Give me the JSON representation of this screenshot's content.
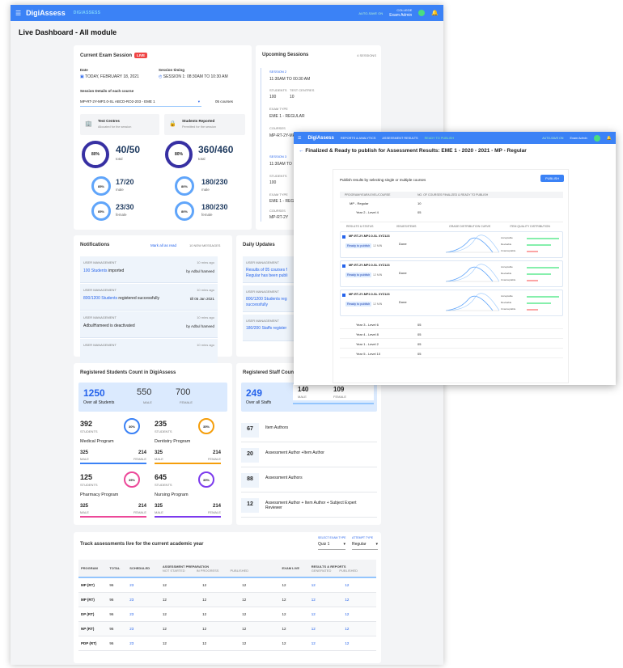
{
  "topbar": {
    "app_name": "DigiAssess",
    "env": "DIGIASSESS",
    "status": "AUTO-SAVE ON",
    "user_role": "COLLEGE",
    "user_name": "Exam Admin"
  },
  "page_title": "Live Dashboard - All module",
  "exam_session": {
    "title": "Current Exam Session",
    "live": "LIVE",
    "date_label": "Date",
    "date_value": "TODAY, FEBRUARY 18, 2021",
    "timing_label": "Session timing",
    "timing_value": "SESSION 1: 08:30AM TO 10:30 AM",
    "course_label": "Session Details of each course",
    "course_value": "MP-RT-2Y-MP2.0-SL ABCD-RO2-203 - EME 1",
    "courses_count": "05 courses",
    "test_centres": "Test Centres",
    "test_centres_sub": "Allocated for the session",
    "students_reported": "Students Reported",
    "students_reported_sub": "Permitted for the session",
    "tc_pct": "80%",
    "tc_value": "40/50",
    "tc_total": "total",
    "tc_male_pct": "85%",
    "tc_male": "17/20",
    "tc_male_label": "male",
    "tc_female_pct": "85%",
    "tc_female": "23/30",
    "tc_female_label": "female",
    "sr_pct": "80%",
    "sr_value": "360/460",
    "sr_total": "total",
    "sr_male_pct": "80%",
    "sr_male": "180/230",
    "sr_male_label": "male",
    "sr_female_pct": "80%",
    "sr_female": "180/230",
    "sr_female_label": "female"
  },
  "upcoming": {
    "title": "Upcoming Sessions",
    "count": "4 SESSIONS",
    "s1_label": "SESSION 2",
    "s1_time": "11:30AM TO 00:30 AM",
    "students_label": "STUDENTS",
    "centres_label": "TEST CENTRES",
    "students": "100",
    "centres": "10",
    "exam_type_label": "EXAM TYPE",
    "exam_type": "EME 1 - REGULAR",
    "courses_label": "COURSES",
    "course1": "MP-RT-2Y-MP2.0-SL ABCD-RO2-203",
    "s2_label": "SESSION 3",
    "s2_time": "11:30AM TO",
    "s2_students": "100",
    "s2_exam": "EME 1 - REG",
    "s2_course": "MP-RT-2Y"
  },
  "notifications": {
    "title": "Notifications",
    "mark": "Mark all as read",
    "new": "10 NEW MESSAGES",
    "items": [
      {
        "cat": "USER MANAGEMENT",
        "time": "10 mins ago",
        "text_b": "100 Students",
        "text": " imported",
        "by": "by Adbul hameed"
      },
      {
        "cat": "USER MANAGEMENT",
        "time": "10 mins ago",
        "text_b": "800/1200 Students",
        "text": " registered successfully",
        "by": "till 05 Jan 2021"
      },
      {
        "cat": "USER MANAGEMENT",
        "time": "10 mins ago",
        "text_b": "",
        "text": "AdbulHameed is deactivated",
        "by": "by Adbul hameed"
      },
      {
        "cat": "USER MANAGEMENT",
        "time": "10 mins ago",
        "text_b": "",
        "text": "",
        "by": ""
      }
    ]
  },
  "daily": {
    "title": "Daily Updates",
    "items": [
      {
        "cat": "USER MANAGEMENT",
        "text": "Results of 05 courses f",
        "text2": "Regular has been publi"
      },
      {
        "cat": "USER MANAGEMENT",
        "text": "800/1200 Students reg",
        "text2": "successfully"
      },
      {
        "cat": "USER MANAGEMENT",
        "text": "180/200 Staffs register",
        "text2": ""
      }
    ]
  },
  "students_count": {
    "title": "Registered Students Count in DigiAssess",
    "total": "1250",
    "total_label": "Over all Students",
    "male": "550",
    "male_label": "MALE",
    "female": "700",
    "female_label": "FEMALE",
    "programs": [
      {
        "count": "392",
        "sub": "STUDENTS",
        "pct": "30%",
        "name": "Medical Program",
        "male": "325",
        "female": "214",
        "color": "#3b82f6"
      },
      {
        "count": "235",
        "sub": "STUDENTS",
        "pct": "35%",
        "name": "Dentistry Program",
        "male": "325",
        "female": "214",
        "color": "#f59e0b"
      },
      {
        "count": "125",
        "sub": "STUDENTS",
        "pct": "35%",
        "name": "Pharmacy Program",
        "male": "325",
        "female": "214",
        "color": "#ec4899"
      },
      {
        "count": "645",
        "sub": "STUDENTS",
        "pct": "35%",
        "name": "Nursing Program",
        "male": "325",
        "female": "214",
        "color": "#7c3aed"
      }
    ],
    "m_label": "MALE",
    "f_label": "FEMALE"
  },
  "staff_count": {
    "title": "Registered Staff Count",
    "total": "249",
    "total_label": "Over all Staffs",
    "male": "140",
    "male_label": "MALE",
    "female": "109",
    "female_label": "FEMALE",
    "roles": [
      {
        "n": "67",
        "name": "Item Authors"
      },
      {
        "n": "20",
        "name": "Assessment Author +Item Author"
      },
      {
        "n": "88",
        "name": "Assessment Authors"
      },
      {
        "n": "12",
        "name": "Assessment Author + Item Author + Subject Expert Reviewer"
      }
    ]
  },
  "track": {
    "title": "Track assessments live for the current academic year",
    "exam_type_label": "SELECT EXAM TYPE",
    "exam_type": "Quiz 1",
    "attempt_label": "ATTEMPT TYPE",
    "attempt": "Regular",
    "headers": {
      "program": "PROGRAM",
      "total": "TOTAL",
      "scheduled": "SCHEDULED",
      "prep": "ASSESSMENT PREPARATION",
      "not_started": "NOT STARTED",
      "in_progress": "IN PROGRESS",
      "published": "PUBLISHED",
      "exam_live": "EXAM LIVE",
      "results": "RESULTS & REPORTS",
      "generated": "GENERATED",
      "r_published": "PUBLISHED"
    },
    "rows": [
      {
        "p": "MP (RT)",
        "t": "96",
        "s": "23",
        "a": "12",
        "b": "12",
        "c": "12",
        "d": "12",
        "e": "12",
        "f": "12"
      },
      {
        "p": "MP (RT)",
        "t": "96",
        "s": "23",
        "a": "12",
        "b": "12",
        "c": "12",
        "d": "12",
        "e": "12",
        "f": "12"
      },
      {
        "p": "DP (RT)",
        "t": "96",
        "s": "23",
        "a": "12",
        "b": "12",
        "c": "12",
        "d": "12",
        "e": "12",
        "f": "12"
      },
      {
        "p": "NP (RT)",
        "t": "96",
        "s": "23",
        "a": "12",
        "b": "12",
        "c": "12",
        "d": "12",
        "e": "12",
        "f": "12"
      },
      {
        "p": "PDP (RT)",
        "t": "96",
        "s": "23",
        "a": "12",
        "b": "12",
        "c": "12",
        "d": "12",
        "e": "12",
        "f": "12"
      }
    ]
  },
  "overlay": {
    "app_name": "DigiAssess",
    "nav1": "REPORTS & ANALYTICS",
    "nav2": "ASSESSMENT RESULTS",
    "nav3": "READY TO PUBLISH",
    "status": "AUTO-SAVE ON",
    "user": "Exam Admin",
    "title": "Finalized & Ready to publish for Assessment Results: EME 1 - 2020 - 2021 - MP - Regular",
    "hint": "Publish results by selecting single or multiple courses",
    "publish": "PUBLISH",
    "col_program": "PROGRAM/YEAR/LEVEL/COURSE",
    "col_courses": "NO. OF COURSES FINALIZED & READY TO PUBLISH",
    "mp_regular": "MP - Regular",
    "mp_count": "10",
    "y2l4": "Year 2 - Level 4",
    "y2l4_count": "05",
    "col_result": "RESULTS & STATUS",
    "col_items": "ISSUES/ITEMS",
    "col_dist": "GRADE DISTRIBUTION CURVE",
    "col_quality": "ITEM QUALITY DISTRIBUTION",
    "courses": [
      {
        "code": "MP-RT-2Y-MP2.0-SL XYZ123",
        "status": "Ready to publish",
        "time": "12 MIN",
        "issues": "Done"
      },
      {
        "code": "MP-RT-2Y-MP2.0-SL XYZ123",
        "status": "Ready to publish",
        "time": "12 MIN",
        "issues": "Done"
      },
      {
        "code": "MP-RT-2Y-MP2.0-SL XYZ123",
        "status": "Ready to publish",
        "time": "12 MIN",
        "issues": "Done"
      }
    ],
    "q_labels": [
      "Acceptable",
      "Revisable",
      "Unacceptable"
    ],
    "levels": [
      {
        "name": "Year 3 - Level 6",
        "count": "05"
      },
      {
        "name": "Year 4 - Level 8",
        "count": "05"
      },
      {
        "name": "Year 1 - Level 2",
        "count": "05"
      },
      {
        "name": "Year 5 - Level 10",
        "count": "05"
      }
    ]
  }
}
